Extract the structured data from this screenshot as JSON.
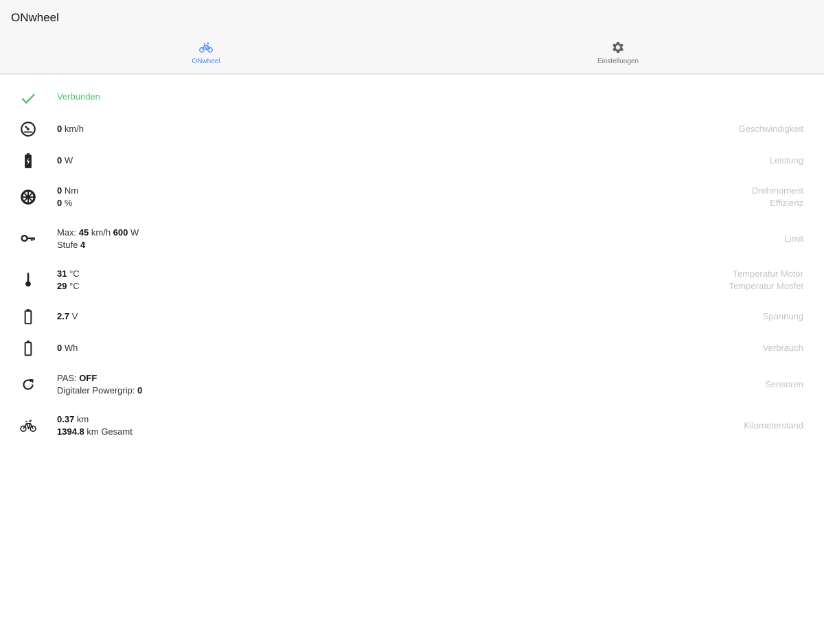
{
  "app": {
    "title": "ONwheel"
  },
  "tabs": [
    {
      "label": "ONwheel",
      "icon": "bicycle-icon",
      "active": true
    },
    {
      "label": "Einstellungen",
      "icon": "gear-icon",
      "active": false
    }
  ],
  "colors": {
    "accent": "#4a8cf0",
    "connected": "#4cc26b",
    "label_gray": "#c3c3c3"
  },
  "status": {
    "icon": "check-icon",
    "text": "Verbunden"
  },
  "rows": {
    "speed": {
      "icon": "speedometer-icon",
      "value": "0",
      "unit": " km/h",
      "label": "Geschwindigkeit"
    },
    "power": {
      "icon": "battery-charging-icon",
      "value": "0",
      "unit": " W",
      "label": "Leistung"
    },
    "torque": {
      "icon": "wheel-icon",
      "torque_value": "0",
      "torque_unit": " Nm",
      "eff_value": "0",
      "eff_unit": " %",
      "label1": "Drehmoment",
      "label2": "Effizienz"
    },
    "limit": {
      "icon": "key-icon",
      "prefix": "Max: ",
      "speed": "45",
      "speed_unit": " km/h ",
      "power": "600",
      "power_unit": " W",
      "stufe_prefix": "Stufe ",
      "stufe": "4",
      "label": "Limit"
    },
    "temp": {
      "icon": "thermometer-icon",
      "motor": "31",
      "motor_unit": " °C",
      "mosfet": "29",
      "mosfet_unit": " °C",
      "label1": "Temperatur Motor",
      "label2": "Temperatur Mosfet"
    },
    "voltage": {
      "icon": "battery-icon",
      "value": "2.7",
      "unit": " V",
      "label": "Spannung"
    },
    "consumption": {
      "icon": "battery-outline-icon",
      "value": "0",
      "unit": " Wh",
      "label": "Verbrauch"
    },
    "sensors": {
      "icon": "refresh-icon",
      "pas_prefix": "PAS: ",
      "pas": "OFF",
      "grip_prefix": "Digitaler Powergrip: ",
      "grip": "0",
      "label": "Sensoren"
    },
    "odometer": {
      "icon": "bicycle-icon",
      "trip": "0.37",
      "trip_unit": " km",
      "total": "1394.8",
      "total_unit": " km Gesamt",
      "label": "Kilometerstand"
    }
  }
}
